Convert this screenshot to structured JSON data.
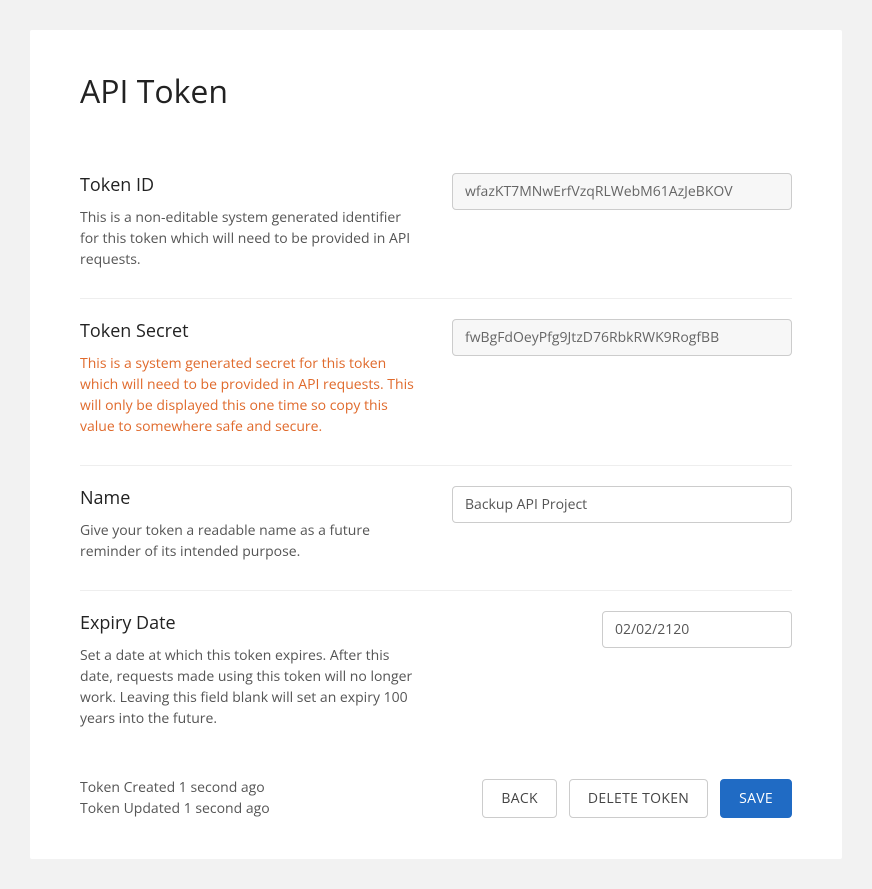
{
  "title": "API Token",
  "fields": {
    "token_id": {
      "label": "Token ID",
      "help": "This is a non-editable system generated identifier for this token which will need to be provided in API requests.",
      "value": "wfazKT7MNwErfVzqRLWebM61AzJeBKOV"
    },
    "token_secret": {
      "label": "Token Secret",
      "help": "This is a system generated secret for this token which will need to be provided in API requests. This will only be displayed this one time so copy this value to somewhere safe and secure.",
      "value": "fwBgFdOeyPfg9JtzD76RbkRWK9RogfBB"
    },
    "name": {
      "label": "Name",
      "help": "Give your token a readable name as a future reminder of its intended purpose.",
      "value": "Backup API Project"
    },
    "expiry": {
      "label": "Expiry Date",
      "help": "Set a date at which this token expires. After this date, requests made using this token will no longer work. Leaving this field blank will set an expiry 100 years into the future.",
      "value": "02/02/2120"
    }
  },
  "meta": {
    "created": "Token Created 1 second ago",
    "updated": "Token Updated 1 second ago"
  },
  "buttons": {
    "back": "BACK",
    "delete": "DELETE TOKEN",
    "save": "SAVE"
  }
}
